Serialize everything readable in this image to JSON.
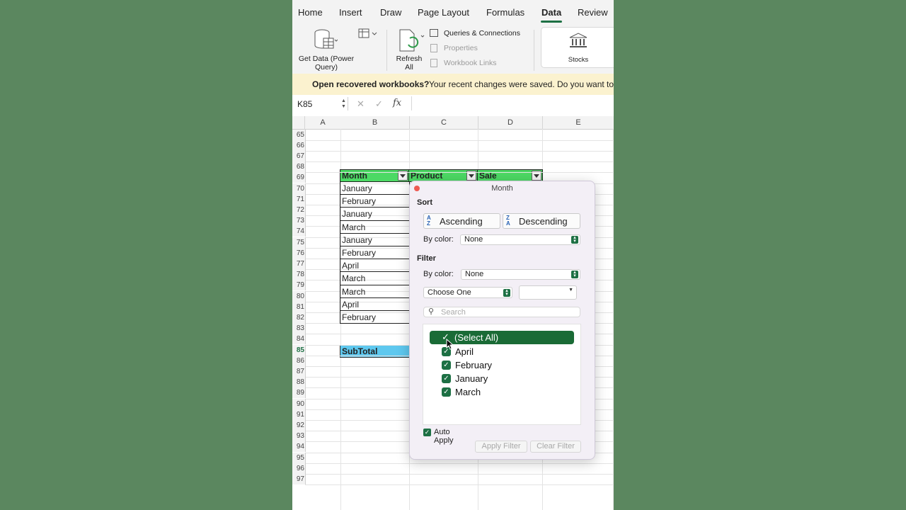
{
  "ribbon": {
    "tabs": [
      "Home",
      "Insert",
      "Draw",
      "Page Layout",
      "Formulas",
      "Data",
      "Review"
    ],
    "active_tab": "Data",
    "get_data_label": "Get Data (Power Query)",
    "refresh_all_label": "Refresh All",
    "queries_label": "Queries & Connections",
    "properties_label": "Properties",
    "workbook_links_label": "Workbook Links",
    "stocks_label": "Stocks"
  },
  "notification": {
    "title": "Open recovered workbooks?",
    "message": "Your recent changes were saved. Do you want to"
  },
  "formula_bar": {
    "name_box": "K85",
    "fx": "fx",
    "value": ""
  },
  "sheet": {
    "columns": [
      "A",
      "B",
      "C",
      "D",
      "E"
    ],
    "rows": [
      "65",
      "66",
      "67",
      "68",
      "69",
      "70",
      "71",
      "72",
      "73",
      "74",
      "75",
      "76",
      "77",
      "78",
      "79",
      "80",
      "81",
      "82",
      "83",
      "84",
      "85",
      "86",
      "87",
      "88",
      "89",
      "90",
      "91",
      "92",
      "93",
      "94",
      "95",
      "96",
      "97"
    ],
    "selected_row": "85",
    "headers": {
      "month": "Month",
      "product": "Product",
      "sale": "Sale"
    },
    "months": [
      "January",
      "February",
      "January",
      "March",
      "January",
      "February",
      "April",
      "March",
      "March",
      "April",
      "February"
    ],
    "subtotal_label": "SubTotal"
  },
  "filter_popup": {
    "title": "Month",
    "sort_label": "Sort",
    "ascending": "Ascending",
    "descending": "Descending",
    "by_color_label": "By color:",
    "sort_color_value": "None",
    "filter_label": "Filter",
    "filter_color_value": "None",
    "choose_one": "Choose One",
    "search_placeholder": "Search",
    "select_all": "(Select All)",
    "items": [
      "April",
      "February",
      "January",
      "March"
    ],
    "auto_apply": "Auto Apply",
    "apply_filter": "Apply Filter",
    "clear_filter": "Clear Filter"
  },
  "colors": {
    "accent": "#1d7044",
    "header_fill": "#4cd964",
    "subtotal_fill": "#5ec8ef"
  }
}
